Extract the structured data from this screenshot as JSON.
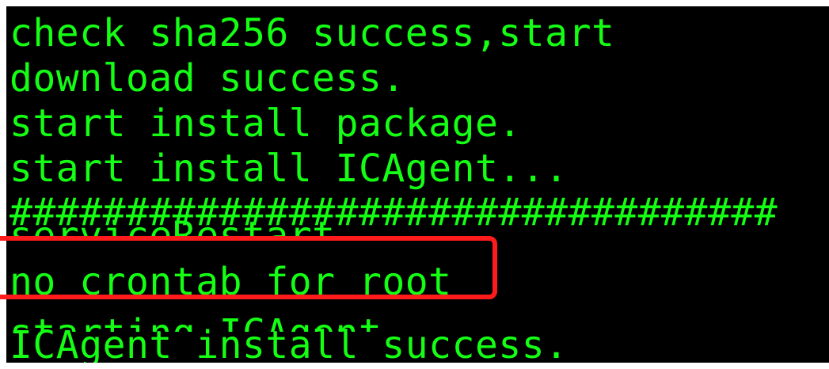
{
  "terminal": {
    "lines": [
      "check sha256 success,start",
      "download success.",
      "start install package.",
      "start install ICAgent...",
      "#################################",
      "serviceRestart",
      "no crontab for root",
      "starting ICAgent...",
      "ICAgent install success."
    ],
    "text_color": "#14ff14",
    "background_color": "#000000"
  },
  "annotation": {
    "highlight_color": "#ff1b1b",
    "highlighted_line": "no crontab for root"
  }
}
